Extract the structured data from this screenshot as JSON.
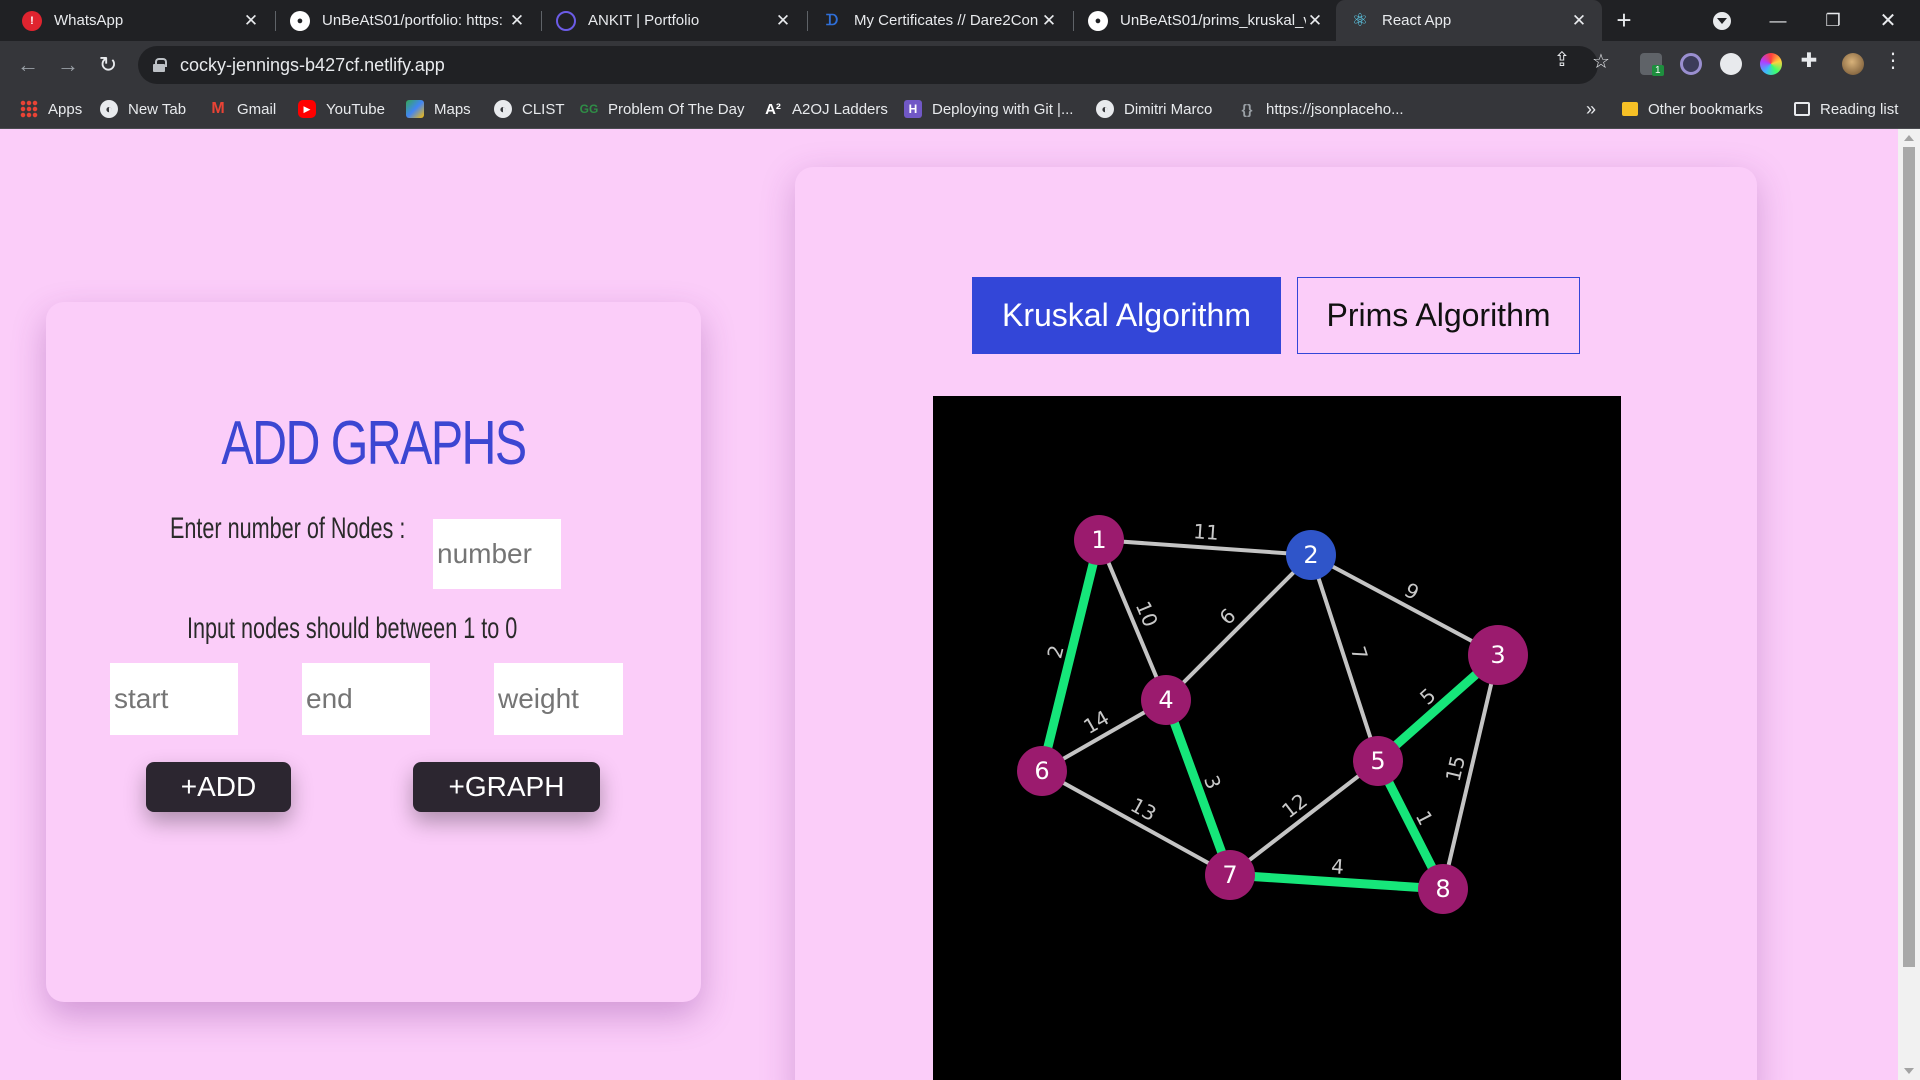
{
  "browser": {
    "tabs": [
      {
        "title": "WhatsApp",
        "icon": "whatsapp-icon",
        "color": "#e0242f"
      },
      {
        "title": "UnBeAtS01/portfolio: https:",
        "icon": "github-icon",
        "color": "#ffffff"
      },
      {
        "title": "ANKIT | Portfolio",
        "icon": "portfolio-icon",
        "color": "#6c5ce7"
      },
      {
        "title": "My Certificates // Dare2Con",
        "icon": "dare2compete-icon",
        "color": "#2f6fd8"
      },
      {
        "title": "UnBeAtS01/prims_kruskal_v",
        "icon": "github-icon",
        "color": "#ffffff"
      },
      {
        "title": "React App",
        "icon": "react-icon",
        "color": "#61dafb",
        "active": true
      }
    ],
    "new_tab_symbol": "+",
    "address": "cocky-jennings-b427cf.netlify.app",
    "bookmarks": [
      {
        "label": "Apps",
        "icon": "apps-grid-icon"
      },
      {
        "label": "New Tab",
        "icon": "globe-icon"
      },
      {
        "label": "Gmail",
        "icon": "gmail-icon"
      },
      {
        "label": "YouTube",
        "icon": "youtube-icon"
      },
      {
        "label": "Maps",
        "icon": "maps-icon"
      },
      {
        "label": "CLIST",
        "icon": "globe-icon"
      },
      {
        "label": "Problem Of The Day",
        "icon": "gfg-icon"
      },
      {
        "label": "A2OJ Ladders",
        "icon": "a2oj-icon"
      },
      {
        "label": "Deploying with Git |...",
        "icon": "heroku-icon"
      },
      {
        "label": "Dimitri Marco",
        "icon": "globe-icon"
      },
      {
        "label": "https://jsonplaceho...",
        "icon": "jsonplaceholder-icon"
      }
    ],
    "bookmarks_overflow": "»",
    "other_bookmarks": "Other bookmarks",
    "reading_list": "Reading list",
    "extension_badge": "1"
  },
  "add_graphs": {
    "title": "ADD GRAPHS",
    "nodes_label": "Enter number of Nodes :",
    "nodes_placeholder": "number",
    "range_label": "Input nodes should between 1 to 0",
    "start_placeholder": "start",
    "end_placeholder": "end",
    "weight_placeholder": "weight",
    "add_button": "+ADD",
    "graph_button": "+GRAPH"
  },
  "algorithms": {
    "kruskal_label": "Kruskal Algorithm",
    "prims_label": "Prims Algorithm",
    "selected": "Kruskal Algorithm"
  },
  "graph": {
    "colors": {
      "background": "#000000",
      "node": "#9b1b6e",
      "node_highlight": "#2f55c9",
      "edge": "#c4c4c4",
      "mst_edge": "#16e67a",
      "label": "#c8c8c8"
    },
    "nodes": [
      {
        "id": "1"
      },
      {
        "id": "2",
        "highlight": true
      },
      {
        "id": "3"
      },
      {
        "id": "4"
      },
      {
        "id": "5"
      },
      {
        "id": "6"
      },
      {
        "id": "7"
      },
      {
        "id": "8"
      }
    ],
    "edges": [
      {
        "from": "1",
        "to": "2",
        "weight": "11",
        "mst": false
      },
      {
        "from": "1",
        "to": "4",
        "weight": "10",
        "mst": false
      },
      {
        "from": "1",
        "to": "6",
        "weight": "2",
        "mst": true
      },
      {
        "from": "2",
        "to": "4",
        "weight": "6",
        "mst": false
      },
      {
        "from": "2",
        "to": "3",
        "weight": "9",
        "mst": false
      },
      {
        "from": "2",
        "to": "5",
        "weight": "7",
        "mst": false
      },
      {
        "from": "4",
        "to": "6",
        "weight": "14",
        "mst": false
      },
      {
        "from": "4",
        "to": "7",
        "weight": "3",
        "mst": true
      },
      {
        "from": "6",
        "to": "7",
        "weight": "13",
        "mst": false
      },
      {
        "from": "5",
        "to": "3",
        "weight": "5",
        "mst": true
      },
      {
        "from": "5",
        "to": "7",
        "weight": "12",
        "mst": false
      },
      {
        "from": "5",
        "to": "8",
        "weight": "1",
        "mst": true
      },
      {
        "from": "3",
        "to": "8",
        "weight": "15",
        "mst": false
      },
      {
        "from": "7",
        "to": "8",
        "weight": "4",
        "mst": true
      }
    ]
  }
}
